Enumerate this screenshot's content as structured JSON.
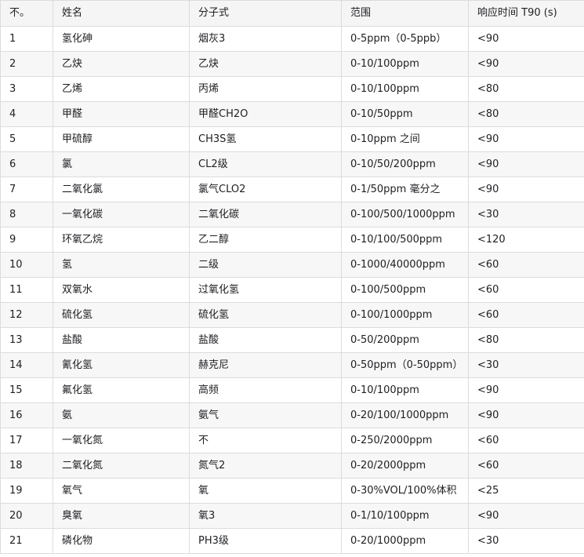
{
  "table": {
    "headers": [
      "不。",
      "姓名",
      "分子式",
      "范围",
      "响应时间 T90 (s)"
    ],
    "rows": [
      [
        "1",
        "氢化砷",
        "烟灰3",
        "0-5ppm（0-5ppb）",
        "<90"
      ],
      [
        "2",
        "乙炔",
        "乙炔",
        "0-10/100ppm",
        "<90"
      ],
      [
        "3",
        "乙烯",
        "丙烯",
        "0-10/100ppm",
        "<80"
      ],
      [
        "4",
        "甲醛",
        "甲醛CH2O",
        "0-10/50ppm",
        "<80"
      ],
      [
        "5",
        "甲硫醇",
        "CH3S氢",
        "0-10ppm 之间",
        "<90"
      ],
      [
        "6",
        "氯",
        "CL2级",
        "0-10/50/200ppm",
        "<90"
      ],
      [
        "7",
        "二氧化氯",
        "氯气CLO2",
        "0-1/50ppm 毫分之",
        "<90"
      ],
      [
        "8",
        "一氧化碳",
        "二氧化碳",
        "0-100/500/1000ppm",
        "<30"
      ],
      [
        "9",
        "环氧乙烷",
        "乙二醇",
        "0-10/100/500ppm",
        "<120"
      ],
      [
        "10",
        "氢",
        "二级",
        "0-1000/40000ppm",
        "<60"
      ],
      [
        "11",
        "双氧水",
        "过氧化氢",
        "0-100/500ppm",
        "<60"
      ],
      [
        "12",
        "硫化氢",
        "硫化氢",
        "0-100/1000ppm",
        "<60"
      ],
      [
        "13",
        "盐酸",
        "盐酸",
        "0-50/200ppm",
        "<80"
      ],
      [
        "14",
        "氰化氢",
        "赫克尼",
        "0-50ppm（0-50ppm）",
        "<30"
      ],
      [
        "15",
        "氟化氢",
        "高频",
        "0-10/100ppm",
        "<90"
      ],
      [
        "16",
        "氨",
        "氨气",
        "0-20/100/1000ppm",
        "<90"
      ],
      [
        "17",
        "一氧化氮",
        "不",
        "0-250/2000ppm",
        "<60"
      ],
      [
        "18",
        "二氧化氮",
        "氮气2",
        "0-20/2000ppm",
        "<60"
      ],
      [
        "19",
        "氧气",
        "氧",
        "0-30%VOL/100%体积",
        "<25"
      ],
      [
        "20",
        "臭氧",
        "氧3",
        "0-1/10/100ppm",
        "<90"
      ],
      [
        "21",
        "磷化物",
        "PH3级",
        "0-20/1000ppm",
        "<30"
      ]
    ]
  }
}
